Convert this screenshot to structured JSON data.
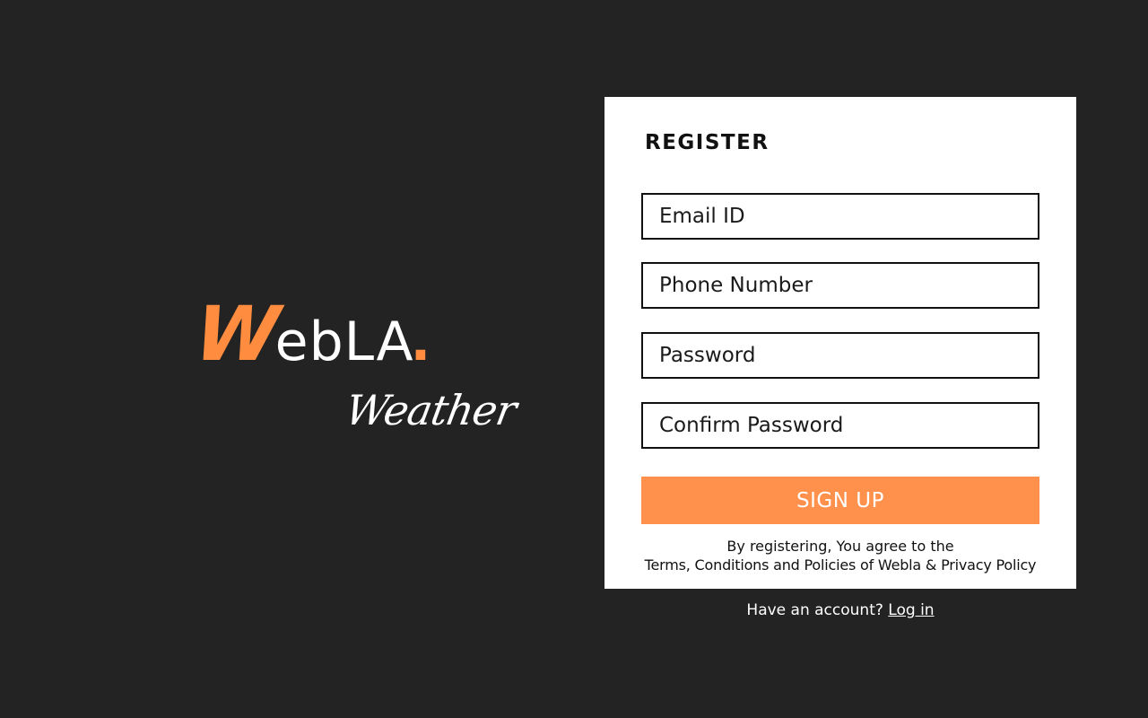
{
  "brand": {
    "logo_first_letter": "W",
    "logo_rest": "ebLA",
    "logo_dot": ".",
    "subtitle": "Weather",
    "accent_color": "#ff8c3f"
  },
  "register": {
    "title": "REGISTER",
    "fields": {
      "email_placeholder": "Email ID",
      "phone_placeholder": "Phone Number",
      "password_placeholder": "Password",
      "confirm_password_placeholder": "Confirm Password"
    },
    "signup_label": "SIGN UP",
    "button_color": "#ff914d",
    "terms_line1": "By registering, You agree to the",
    "terms_line2": "Terms, Conditions and Policies of Webla & Privacy Policy"
  },
  "footer": {
    "account_prompt": "Have an account?",
    "login_label": "Log in"
  },
  "colors": {
    "background": "#232323",
    "card": "#ffffff"
  }
}
